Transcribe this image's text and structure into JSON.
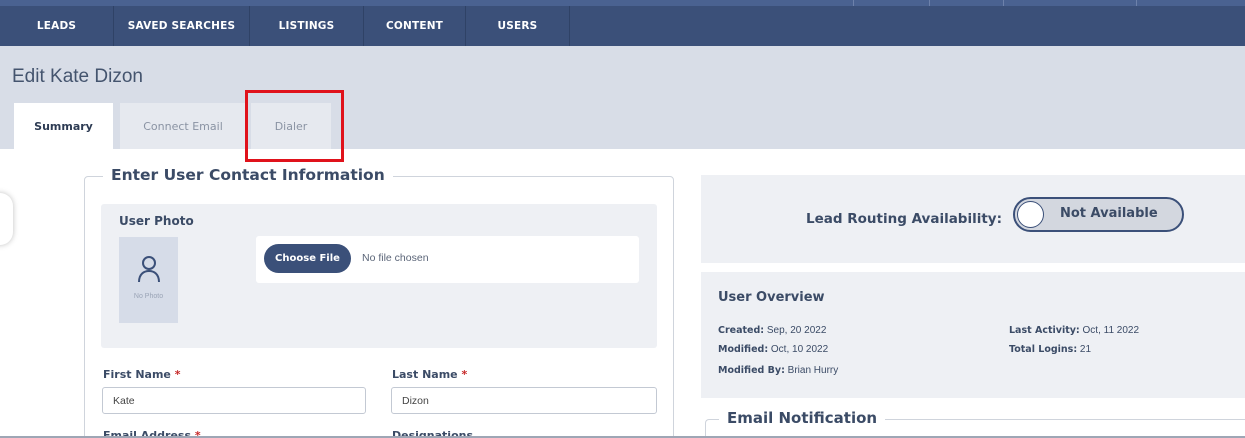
{
  "nav": {
    "items": [
      {
        "label": "LEADS"
      },
      {
        "label": "SAVED SEARCHES"
      },
      {
        "label": "LISTINGS"
      },
      {
        "label": "CONTENT"
      },
      {
        "label": "USERS"
      }
    ]
  },
  "page": {
    "title": "Edit Kate Dizon"
  },
  "tabs": [
    {
      "label": "Summary",
      "active": true
    },
    {
      "label": "Connect Email",
      "active": false
    },
    {
      "label": "Dialer",
      "active": false
    }
  ],
  "contact": {
    "legend": "Enter User Contact Information",
    "photo_label": "User Photo",
    "no_photo": "No Photo",
    "choose_file": "Choose File",
    "no_file": "No file chosen",
    "first_name_label": "First Name",
    "first_name_value": "Kate",
    "last_name_label": "Last Name",
    "last_name_value": "Dizon",
    "email_label": "Email Address",
    "designations_label": "Designations",
    "required_mark": "*"
  },
  "lead_routing": {
    "label": "Lead Routing Availability:",
    "status": "Not Available"
  },
  "overview": {
    "title": "User Overview",
    "created_label": "Created:",
    "created_value": "Sep, 20 2022",
    "modified_label": "Modified:",
    "modified_value": "Oct, 10 2022",
    "modified_by_label": "Modified By:",
    "modified_by_value": "Brian Hurry",
    "last_activity_label": "Last Activity:",
    "last_activity_value": "Oct, 11 2022",
    "total_logins_label": "Total Logins:",
    "total_logins_value": "21"
  },
  "email_notification": {
    "legend": "Email Notification"
  },
  "colors": {
    "nav": "#3b5079",
    "highlight": "#e0121b",
    "accent": "#3b5079"
  }
}
